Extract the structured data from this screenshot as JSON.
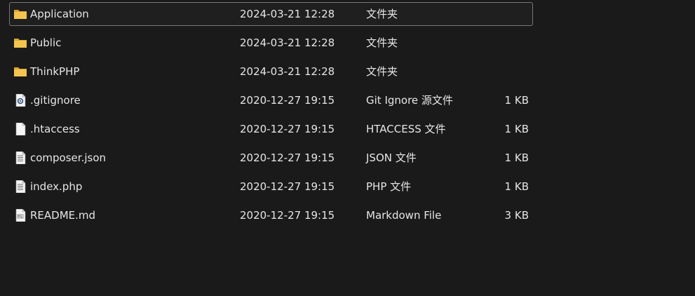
{
  "files": [
    {
      "name": "Application",
      "modified": "2024-03-21 12:28",
      "type": "文件夹",
      "size": "",
      "icon": "folder-icon",
      "selected": true
    },
    {
      "name": "Public",
      "modified": "2024-03-21 12:28",
      "type": "文件夹",
      "size": "",
      "icon": "folder-icon",
      "selected": false
    },
    {
      "name": "ThinkPHP",
      "modified": "2024-03-21 12:28",
      "type": "文件夹",
      "size": "",
      "icon": "folder-icon",
      "selected": false
    },
    {
      "name": ".gitignore",
      "modified": "2020-12-27 19:15",
      "type": "Git Ignore 源文件",
      "size": "1 KB",
      "icon": "settings-file-icon",
      "selected": false
    },
    {
      "name": ".htaccess",
      "modified": "2020-12-27 19:15",
      "type": "HTACCESS 文件",
      "size": "1 KB",
      "icon": "blank-file-icon",
      "selected": false
    },
    {
      "name": "composer.json",
      "modified": "2020-12-27 19:15",
      "type": "JSON 文件",
      "size": "1 KB",
      "icon": "text-file-icon",
      "selected": false
    },
    {
      "name": "index.php",
      "modified": "2020-12-27 19:15",
      "type": "PHP 文件",
      "size": "1 KB",
      "icon": "text-file-icon",
      "selected": false
    },
    {
      "name": "README.md",
      "modified": "2020-12-27 19:15",
      "type": "Markdown File",
      "size": "3 KB",
      "icon": "markdown-file-icon",
      "selected": false
    }
  ],
  "colors": {
    "background": "#1a1a1a",
    "text": "#e6e6e6",
    "selection_border": "#767676",
    "folder": "#f0c24b"
  }
}
